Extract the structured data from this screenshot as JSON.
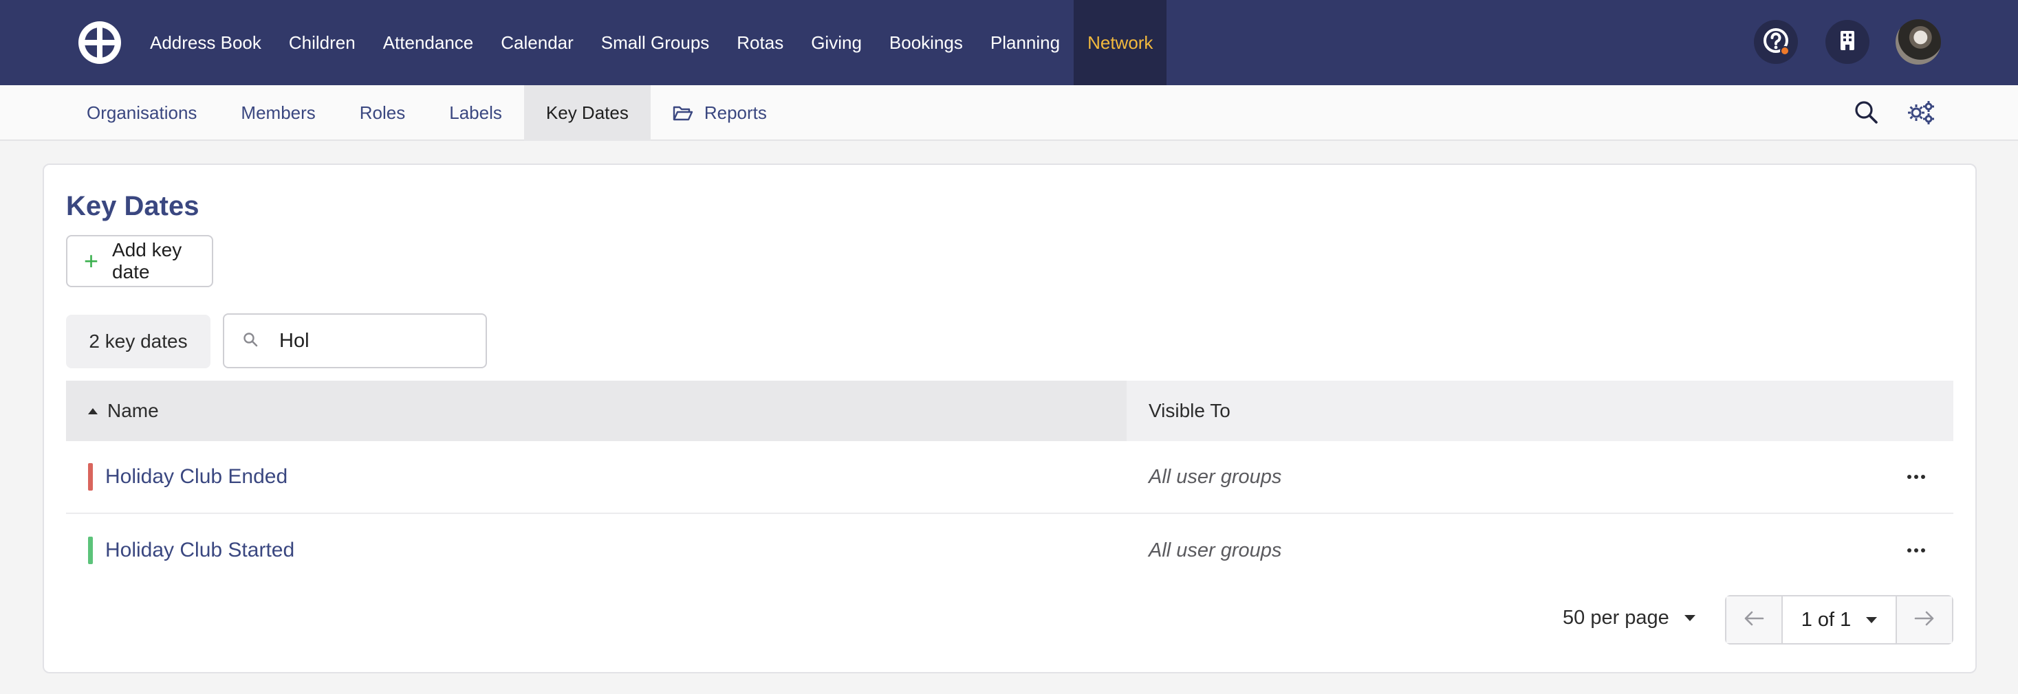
{
  "top_nav": {
    "items": [
      "Address Book",
      "Children",
      "Attendance",
      "Calendar",
      "Small Groups",
      "Rotas",
      "Giving",
      "Bookings",
      "Planning",
      "Network"
    ],
    "active": "Network",
    "active_color": "#f2b93d",
    "background": "#323969",
    "help_icon": "help-circle-icon",
    "org_icon": "building-icon",
    "notification_color": "#f07a2a"
  },
  "sub_nav": {
    "items": [
      "Organisations",
      "Members",
      "Roles",
      "Labels",
      "Key Dates",
      "Reports"
    ],
    "active": "Key Dates",
    "reports_icon": "folder-open-icon",
    "search_icon": "search-icon",
    "settings_icon": "gears-icon"
  },
  "page": {
    "title": "Key Dates",
    "add_button": "Add key date",
    "count": "2 key dates",
    "search_value": "Hol"
  },
  "table": {
    "columns": [
      "Name",
      "Visible To"
    ],
    "sort_column": "Name",
    "sort_direction": "ascending",
    "rows": [
      {
        "name": "Holiday Club Ended",
        "visible_to": "All user groups",
        "color": "#d9655d"
      },
      {
        "name": "Holiday Club Started",
        "visible_to": "All user groups",
        "color": "#5cc37a"
      }
    ]
  },
  "pagination": {
    "per_page": "50 per page",
    "page_label": "1 of 1"
  }
}
